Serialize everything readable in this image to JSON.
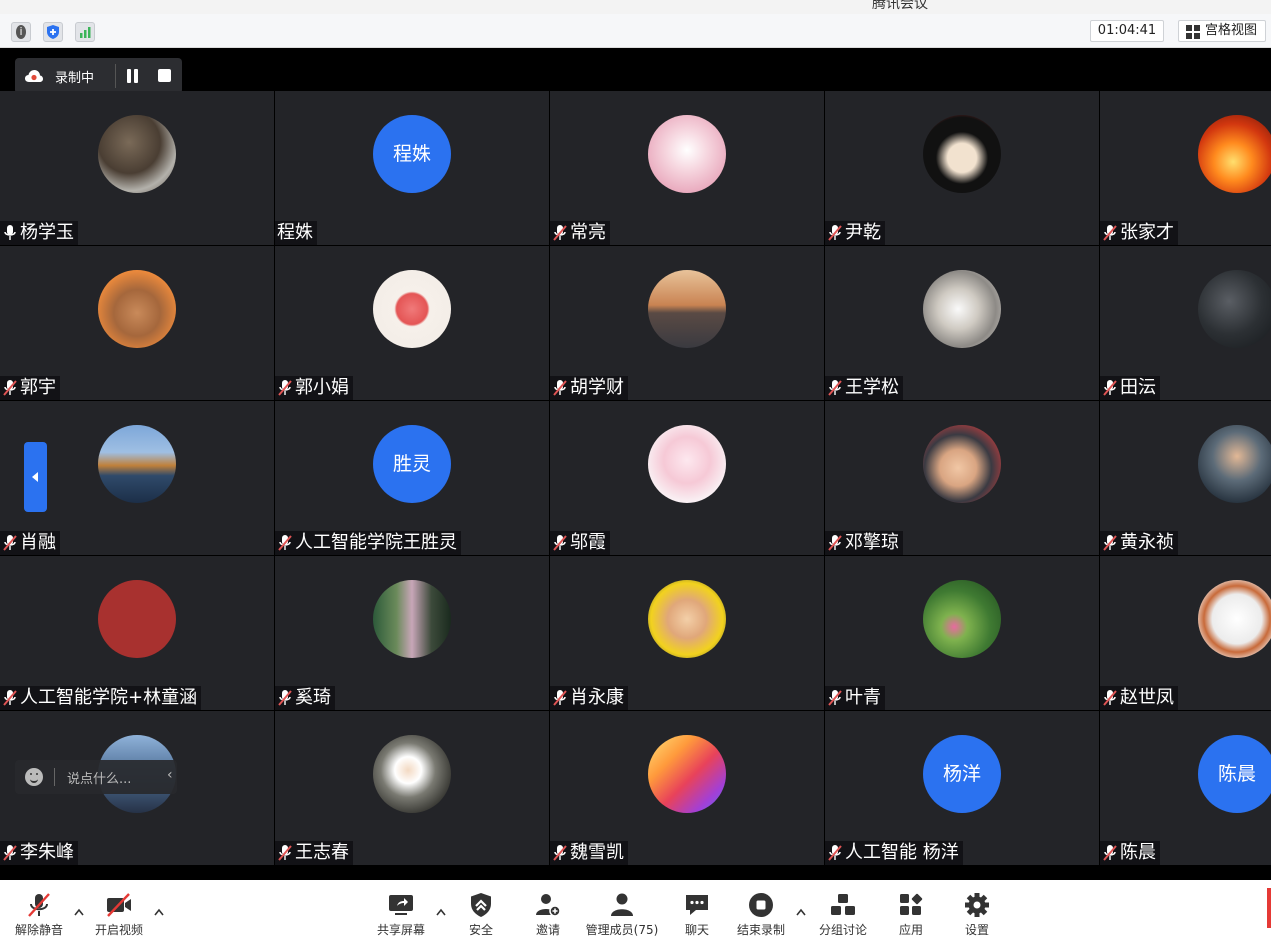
{
  "window": {
    "title": "腾讯会议"
  },
  "statusbar": {
    "timer": "01:04:41",
    "grid_view_label": "宫格视图",
    "info_glyph": "i",
    "icons": [
      "info-icon",
      "security-shield-icon",
      "signal-strength-icon"
    ]
  },
  "recording": {
    "label": "录制中",
    "icons": [
      "cloud-record-icon",
      "pause-icon",
      "stop-icon"
    ]
  },
  "colors": {
    "accent": "#2b72f0",
    "tile_bg": "#232428",
    "muted_mic": "#e05555",
    "recording": "#e04a3a"
  },
  "participants": [
    {
      "name": "杨学玉",
      "avatar": "photo",
      "mic": "on"
    },
    {
      "name": "程姝",
      "avatar_text": "程姝",
      "mic": "none"
    },
    {
      "name": "常亮",
      "avatar": "photo",
      "mic": "muted"
    },
    {
      "name": "尹乾",
      "avatar": "photo",
      "mic": "muted"
    },
    {
      "name": "张家才",
      "avatar": "photo",
      "mic": "muted"
    },
    {
      "name": "郭宇",
      "avatar": "photo",
      "mic": "muted"
    },
    {
      "name": "郭小娟",
      "avatar": "photo",
      "mic": "muted"
    },
    {
      "name": "胡学财",
      "avatar": "photo",
      "mic": "muted"
    },
    {
      "name": "王学松",
      "avatar": "photo",
      "mic": "muted"
    },
    {
      "name": "田沄",
      "avatar": "photo",
      "mic": "muted"
    },
    {
      "name": "肖融",
      "avatar": "photo",
      "mic": "muted"
    },
    {
      "name": "人工智能学院王胜灵",
      "avatar_text": "胜灵",
      "mic": "muted"
    },
    {
      "name": "邬霞",
      "avatar": "photo",
      "mic": "muted"
    },
    {
      "name": "邓擎琼",
      "avatar": "photo",
      "mic": "muted"
    },
    {
      "name": "黄永祯",
      "avatar": "photo",
      "mic": "muted"
    },
    {
      "name": "人工智能学院+林童涵",
      "avatar": "photo",
      "mic": "muted"
    },
    {
      "name": "奚琦",
      "avatar": "photo",
      "mic": "muted"
    },
    {
      "name": "肖永康",
      "avatar": "photo",
      "mic": "muted"
    },
    {
      "name": "叶青",
      "avatar": "photo",
      "mic": "muted"
    },
    {
      "name": "赵世凤",
      "avatar": "photo",
      "mic": "muted"
    },
    {
      "name": "李朱峰",
      "avatar": "photo",
      "mic": "muted"
    },
    {
      "name": "王志春",
      "avatar": "photo",
      "mic": "muted"
    },
    {
      "name": "魏雪凯",
      "avatar": "photo",
      "mic": "muted"
    },
    {
      "name": "人工智能 杨洋",
      "avatar_text": "杨洋",
      "mic": "muted"
    },
    {
      "name": "陈晨",
      "avatar_text": "陈晨",
      "mic": "muted"
    }
  ],
  "chat": {
    "placeholder": "说点什么...",
    "icons": [
      "emoji-icon",
      "chevron-left-icon"
    ]
  },
  "toolbar": {
    "unmute": "解除静音",
    "start_video": "开启视频",
    "share_screen": "共享屏幕",
    "security": "安全",
    "invite": "邀请",
    "manage_members": "管理成员(75)",
    "chat": "聊天",
    "end_recording": "结束录制",
    "breakout": "分组讨论",
    "apps": "应用",
    "settings": "设置"
  }
}
